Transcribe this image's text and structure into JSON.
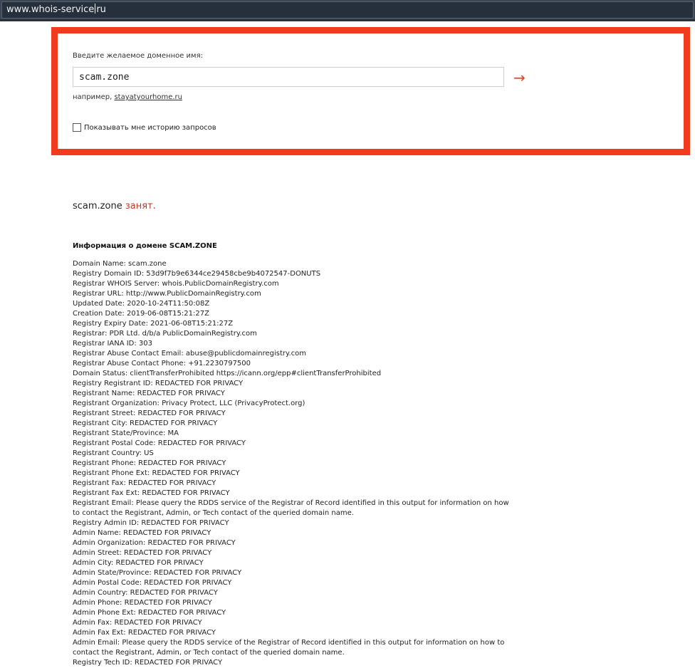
{
  "browser": {
    "url_before_caret": "www.whois-service",
    "url_after_caret": "ru"
  },
  "search": {
    "label": "Введите желаемое доменное имя:",
    "input_value": "scam.zone",
    "submit_icon": "→",
    "example_prefix": "например,",
    "example_link": "stayatyourhome.ru",
    "history_label": "Показывать мне историю запросов"
  },
  "result": {
    "domain": "scam.zone",
    "status": "занят.",
    "info_heading": "Информация о домене SCAM.ZONE"
  },
  "whois_lines": [
    "Domain Name: scam.zone",
    "Registry Domain ID: 53d9f7b9e6344ce29458cbe9b4072547-DONUTS",
    "Registrar WHOIS Server: whois.PublicDomainRegistry.com",
    "Registrar URL: http://www.PublicDomainRegistry.com",
    "Updated Date: 2020-10-24T11:50:08Z",
    "Creation Date: 2019-06-08T15:21:27Z",
    "Registry Expiry Date: 2021-06-08T15:21:27Z",
    "Registrar: PDR Ltd. d/b/a PublicDomainRegistry.com",
    "Registrar IANA ID: 303",
    "Registrar Abuse Contact Email: abuse@publicdomainregistry.com",
    "Registrar Abuse Contact Phone: +91.2230797500",
    "Domain Status: clientTransferProhibited https://icann.org/epp#clientTransferProhibited",
    "Registry Registrant ID: REDACTED FOR PRIVACY",
    "Registrant Name: REDACTED FOR PRIVACY",
    "Registrant Organization: Privacy Protect, LLC (PrivacyProtect.org)",
    "Registrant Street: REDACTED FOR PRIVACY",
    "Registrant City: REDACTED FOR PRIVACY",
    "Registrant State/Province: MA",
    "Registrant Postal Code: REDACTED FOR PRIVACY",
    "Registrant Country: US",
    "Registrant Phone: REDACTED FOR PRIVACY",
    "Registrant Phone Ext: REDACTED FOR PRIVACY",
    "Registrant Fax: REDACTED FOR PRIVACY",
    "Registrant Fax Ext: REDACTED FOR PRIVACY",
    "Registrant Email: Please query the RDDS service of the Registrar of Record identified in this output for information on how to contact the Registrant, Admin, or Tech contact of the queried domain name.",
    "Registry Admin ID: REDACTED FOR PRIVACY",
    "Admin Name: REDACTED FOR PRIVACY",
    "Admin Organization: REDACTED FOR PRIVACY",
    "Admin Street: REDACTED FOR PRIVACY",
    "Admin City: REDACTED FOR PRIVACY",
    "Admin State/Province: REDACTED FOR PRIVACY",
    "Admin Postal Code: REDACTED FOR PRIVACY",
    "Admin Country: REDACTED FOR PRIVACY",
    "Admin Phone: REDACTED FOR PRIVACY",
    "Admin Phone Ext: REDACTED FOR PRIVACY",
    "Admin Fax: REDACTED FOR PRIVACY",
    "Admin Fax Ext: REDACTED FOR PRIVACY",
    "Admin Email: Please query the RDDS service of the Registrar of Record identified in this output for information on how to contact the Registrant, Admin, or Tech contact of the queried domain name.",
    "Registry Tech ID: REDACTED FOR PRIVACY"
  ],
  "colors": {
    "highlight_border": "#f23a1c",
    "status_busy": "#c0392b",
    "arrow": "#e0452b"
  }
}
